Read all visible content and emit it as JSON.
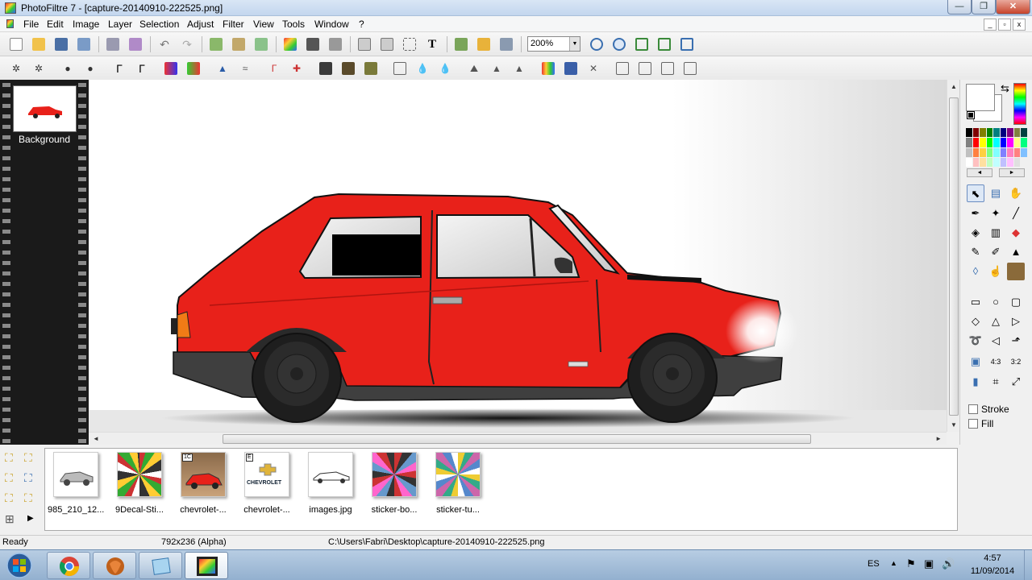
{
  "window": {
    "title": "PhotoFiltre 7 - [capture-20140910-222525.png]"
  },
  "window_buttons": {
    "minimize": "—",
    "maximize": "❐",
    "close": "✕"
  },
  "menu": [
    "File",
    "Edit",
    "Image",
    "Layer",
    "Selection",
    "Adjust",
    "Filter",
    "View",
    "Tools",
    "Window",
    "?"
  ],
  "mdi_buttons": {
    "minimize": "_",
    "restore": "▫",
    "close": "x"
  },
  "toolbar": {
    "zoom_value": "200%",
    "zoom_dropdown": "▼"
  },
  "layers": {
    "layer_name": "Background"
  },
  "tools_panel": {
    "stroke_label": "Stroke",
    "fill_label": "Fill",
    "palette_prev": "◄",
    "palette_next": "►"
  },
  "files": [
    {
      "name": "985_210_12..."
    },
    {
      "name": "9Decal-Sti..."
    },
    {
      "name": "chevrolet-...",
      "badge": "1C"
    },
    {
      "name": "chevrolet-...",
      "badge": "E",
      "logo_text": "CHEVROLET"
    },
    {
      "name": "images.jpg"
    },
    {
      "name": "sticker-bo..."
    },
    {
      "name": "sticker-tu..."
    }
  ],
  "status": {
    "state": "Ready",
    "dimensions": "792x236 (Alpha)",
    "path": "C:\\Users\\Fabri\\Desktop\\capture-20140910-222525.png"
  },
  "taskbar": {
    "language": "ES",
    "time": "4:57",
    "date": "11/09/2014"
  },
  "colors": {
    "car_body": "#e8211a",
    "accent_active": "#3d6fb0"
  }
}
